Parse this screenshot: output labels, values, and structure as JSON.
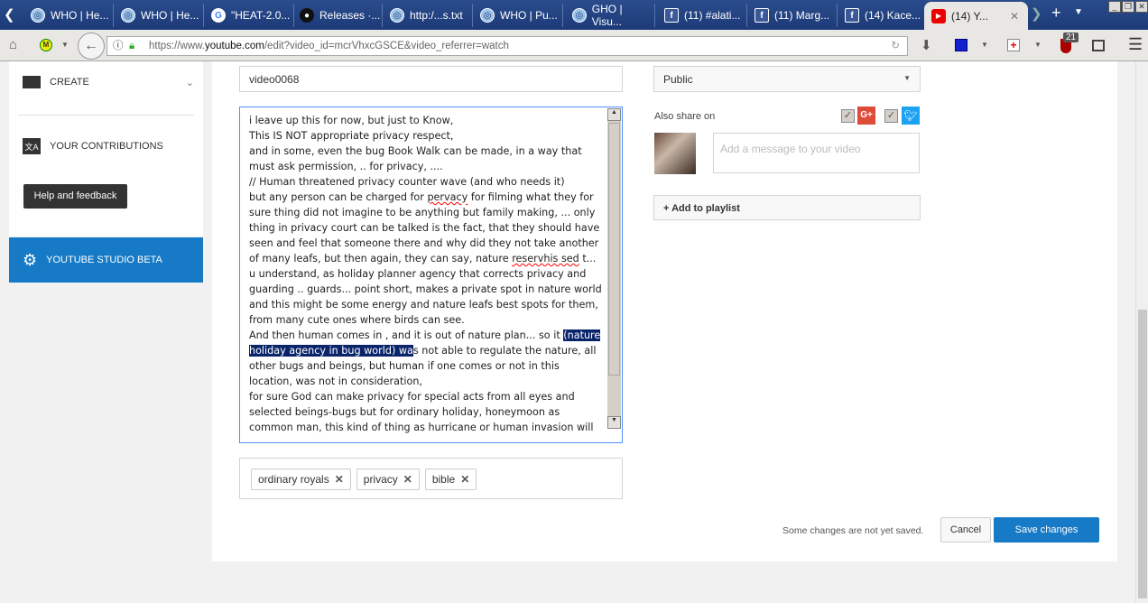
{
  "browser": {
    "tabs": [
      {
        "label": "WHO | He...",
        "icon": "who-icon"
      },
      {
        "label": "WHO | He...",
        "icon": "who-icon"
      },
      {
        "label": "\"HEAT-2.0...",
        "icon": "google-icon"
      },
      {
        "label": "Releases ·...",
        "icon": "github-icon"
      },
      {
        "label": "http:/...s.txt",
        "icon": "who-icon"
      },
      {
        "label": "WHO | Pu...",
        "icon": "who-icon"
      },
      {
        "label": "GHO | Visu...",
        "icon": "who-icon"
      },
      {
        "label": "(11) #alati...",
        "icon": "facebook-icon"
      },
      {
        "label": "(11) Marg...",
        "icon": "facebook-icon"
      },
      {
        "label": "(14) Kace...",
        "icon": "facebook-icon"
      },
      {
        "label": "(14) Y...",
        "icon": "youtube-icon"
      }
    ],
    "url_prefix": "https://www.",
    "url_domain": "youtube.com",
    "url_path": "/edit?video_id=mcrVhxcGSCE&video_referrer=watch",
    "badge_count": "21"
  },
  "sidebar": {
    "create": "CREATE",
    "contributions": "YOUR CONTRIBUTIONS",
    "help": "Help and feedback",
    "studio": "YOUTUBE STUDIO BETA"
  },
  "editor": {
    "title_value": "video0068",
    "description_lines": [
      "i leave up this for now, but just to Know,",
      "This IS NOT appropriate privacy respect,",
      "and in some, even the bug Book Walk can be made, in a way that",
      "must ask permission, .. for privacy, ....",
      "// Human threatened privacy counter wave (and who needs it)"
    ],
    "line6a": "but any person can be charged for ",
    "line6b": "pervacy",
    "line6c": " for filming what they for",
    "description_lines2": [
      "sure thing did not imagine to be anything but family making, ... only",
      "thing in privacy court can be talked is the fact, that they should have",
      "seen and feel that someone  there and why did they not take another"
    ],
    "line10a": "of many leafs, but then again, they can say, nature ",
    "line10b": "reservhis sed",
    "line10c": " t...",
    "description_lines3": [
      "u understand, as holiday planner agency that corrects privacy and",
      "guarding .. guards...  point short, makes a private spot in nature world",
      "and this might be some energy and nature leafs best spots for them,",
      "from many cute ones where birds can see."
    ],
    "line15a": "And then human comes in , and it is out of nature plan...  so it ",
    "line15b": "(nature",
    "line16a": "holiday agency in bug world) wa",
    "line16b": "s not able to regulate the nature, all",
    "description_lines4": [
      "other bugs and beings, but human if one comes or not in this",
      "location, was not in consideration,",
      "for sure God can make privacy for special acts from all eyes and",
      "selected beings-bugs but for ordinary holiday, honeymoon as",
      "common man, this kind of thing as hurricane or human invasion will"
    ],
    "tags": [
      "ordinary royals",
      "privacy",
      "bible"
    ],
    "privacy": "Public",
    "also_share": "Also share on",
    "message_placeholder": "Add a message to your video",
    "add_playlist": "+ Add to playlist",
    "unsaved": "Some changes are not yet saved.",
    "cancel": "Cancel",
    "save": "Save changes"
  },
  "colors": {
    "accent": "#167ac6",
    "selection": "#0a246a"
  }
}
